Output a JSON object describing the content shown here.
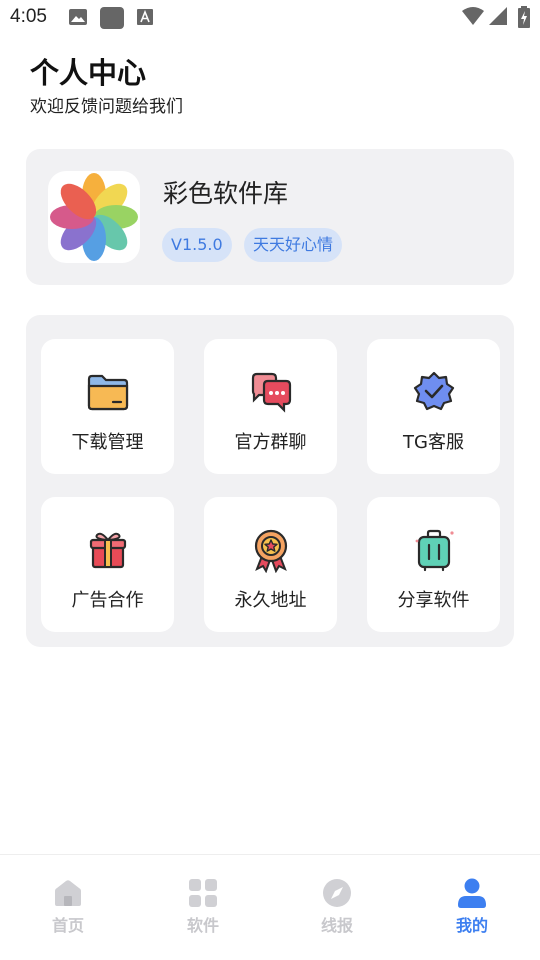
{
  "status_bar": {
    "time": "4:05"
  },
  "header": {
    "title": "个人中心",
    "subtitle": "欢迎反馈问题给我们"
  },
  "app_card": {
    "name": "彩色软件库",
    "version": "V1.5.0",
    "slogan": "天天好心情"
  },
  "grid": {
    "items": [
      {
        "label": "下载管理",
        "icon": "folder-icon"
      },
      {
        "label": "官方群聊",
        "icon": "chat-bubbles-icon"
      },
      {
        "label": "TG客服",
        "icon": "verified-badge-icon"
      },
      {
        "label": "广告合作",
        "icon": "gift-icon"
      },
      {
        "label": "永久地址",
        "icon": "medal-icon"
      },
      {
        "label": "分享软件",
        "icon": "suitcase-icon"
      }
    ]
  },
  "bottom_nav": {
    "items": [
      {
        "label": "首页",
        "icon": "home-icon"
      },
      {
        "label": "软件",
        "icon": "apps-grid-icon"
      },
      {
        "label": "线报",
        "icon": "compass-icon"
      },
      {
        "label": "我的",
        "icon": "profile-icon",
        "active": true
      }
    ]
  },
  "colors": {
    "accent": "#3d7ff0",
    "panel_bg": "#f1f1f3",
    "tag_bg": "#d6e3f8",
    "tag_text": "#3f7ae0",
    "inactive_nav": "#c8c8cc"
  }
}
